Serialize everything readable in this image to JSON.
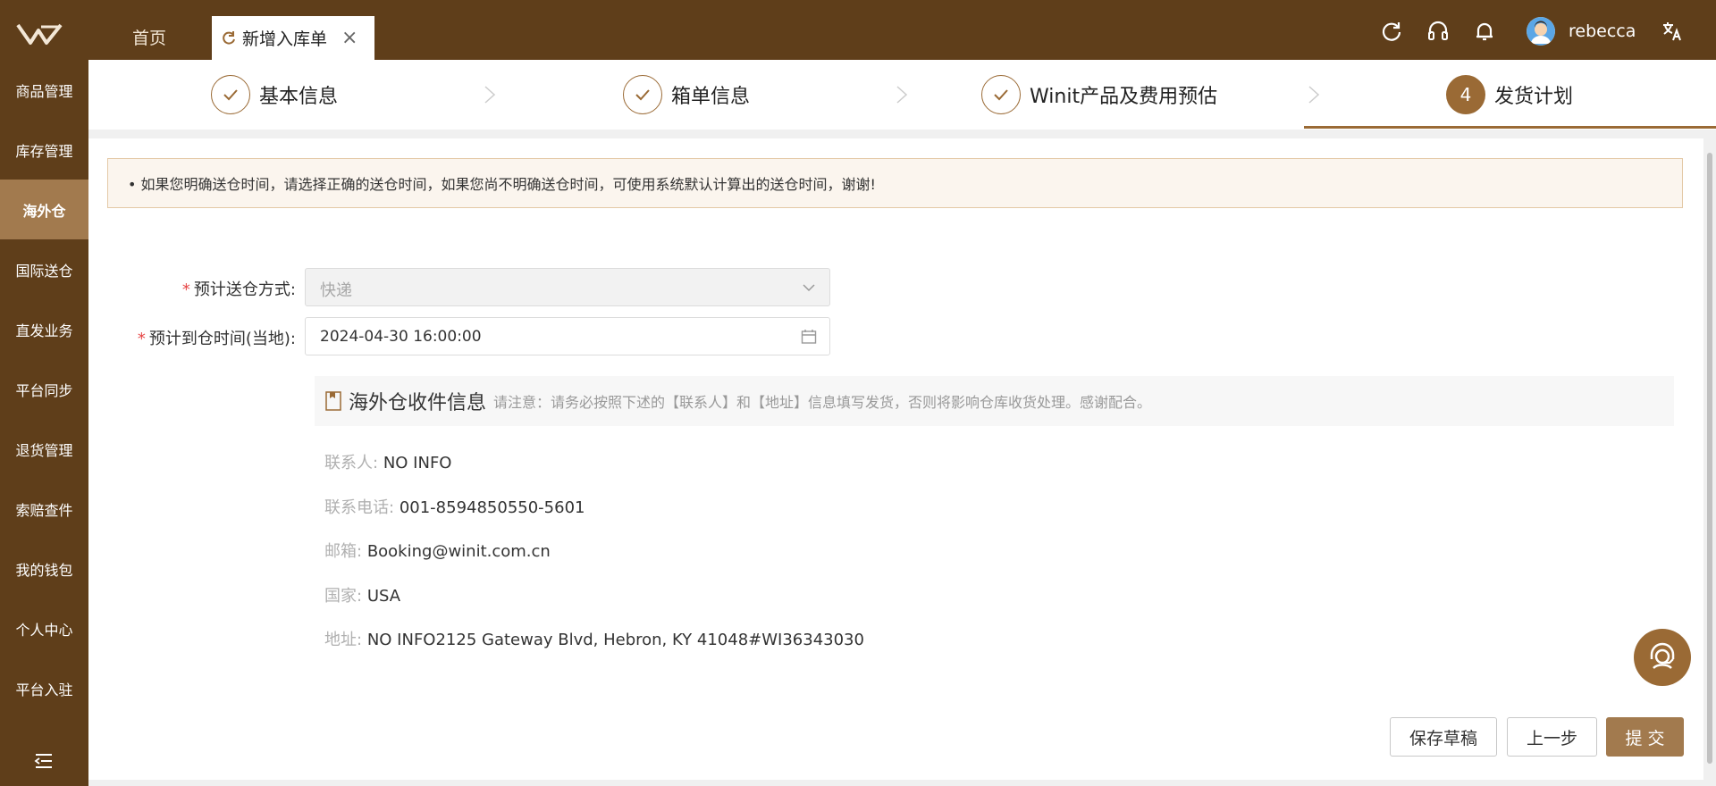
{
  "header": {
    "tabs": [
      {
        "label": "首页"
      },
      {
        "label": "新增入库单"
      }
    ],
    "username": "rebecca",
    "icons": [
      "logo-icon",
      "refresh-icon",
      "headset-icon",
      "bell-icon",
      "avatar",
      "translate-icon"
    ]
  },
  "sidebar": {
    "items": [
      {
        "label": "商品管理"
      },
      {
        "label": "库存管理"
      },
      {
        "label": "海外仓"
      },
      {
        "label": "国际送仓"
      },
      {
        "label": "直发业务"
      },
      {
        "label": "平台同步"
      },
      {
        "label": "退货管理"
      },
      {
        "label": "索赔查件"
      },
      {
        "label": "我的钱包"
      },
      {
        "label": "个人中心"
      },
      {
        "label": "平台入驻"
      }
    ],
    "active_item": "海外仓"
  },
  "steps": [
    {
      "label": "基本信息",
      "status": "done"
    },
    {
      "label": "箱单信息",
      "status": "done"
    },
    {
      "label": "Winit产品及费用预估",
      "status": "done"
    },
    {
      "label": "发货计划",
      "number": "4",
      "status": "active"
    }
  ],
  "notice": "• 如果您明确送仓时间，请选择正确的送仓时间，如果您尚不明确送仓时间，可使用系统默认计算出的送仓时间，谢谢!",
  "form": {
    "method_label": "预计送仓方式:",
    "method_value": "快递",
    "time_label": "预计到仓时间(当地):",
    "time_value": "2024-04-30 16:00:00",
    "required_mark": "*"
  },
  "receiver": {
    "title": "海外仓收件信息",
    "note": "请注意：请务必按照下述的【联系人】和【地址】信息填写发货，否则将影响仓库收货处理。感谢配合。",
    "rows": [
      {
        "key": "联系人:",
        "value": "NO INFO"
      },
      {
        "key": "联系电话:",
        "value": "001-8594850550-5601"
      },
      {
        "key": "邮箱:",
        "value": "Booking@winit.com.cn"
      },
      {
        "key": "国家:",
        "value": "USA"
      },
      {
        "key": "地址:",
        "value": "NO INFO2125 Gateway Blvd, Hebron, KY 41048#WI36343030"
      }
    ]
  },
  "buttons": {
    "save_draft": "保存草稿",
    "prev": "上一步",
    "submit": "提 交"
  },
  "colors": {
    "brand_dark": "#5f3e1a",
    "brand": "#9a6a35",
    "brand_light": "#a27a4e",
    "required": "#e64545"
  }
}
